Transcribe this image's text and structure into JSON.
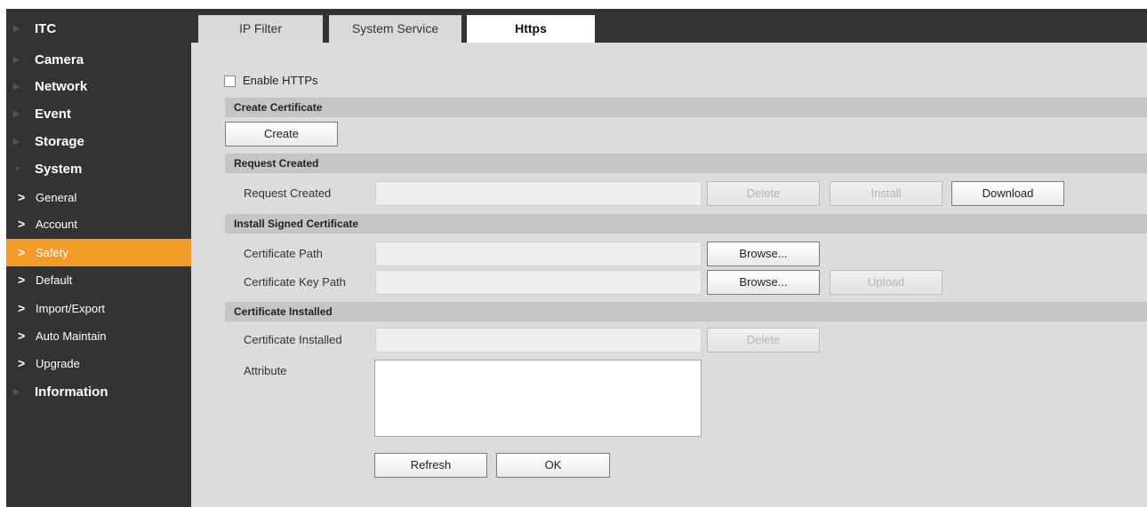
{
  "sidebar": {
    "top_items": [
      {
        "label": "ITC"
      },
      {
        "label": "Camera"
      },
      {
        "label": "Network"
      },
      {
        "label": "Event"
      },
      {
        "label": "Storage"
      },
      {
        "label": "System"
      }
    ],
    "system_subitems": [
      {
        "label": "General"
      },
      {
        "label": "Account"
      },
      {
        "label": "Safety",
        "active": true
      },
      {
        "label": "Default"
      },
      {
        "label": "Import/Export"
      },
      {
        "label": "Auto Maintain"
      },
      {
        "label": "Upgrade"
      }
    ],
    "bottom_item": {
      "label": "Information"
    },
    "active_color": "#f39b27"
  },
  "tabs": [
    {
      "label": "IP Filter"
    },
    {
      "label": "System Service"
    },
    {
      "label": "Https",
      "active": true
    }
  ],
  "https": {
    "enable_label": "Enable HTTPs",
    "enable_checked": false,
    "sections": {
      "create": "Create Certificate",
      "request": "Request Created",
      "install": "Install Signed Certificate",
      "installed": "Certificate Installed"
    },
    "create_button": "Create",
    "request_created_label": "Request Created",
    "request_created_value": "",
    "delete_button": "Delete",
    "install_button": "Install",
    "download_button": "Download",
    "cert_path_label": "Certificate Path",
    "cert_path_value": "",
    "cert_key_path_label": "Certificate Key Path",
    "cert_key_path_value": "",
    "browse_button": "Browse...",
    "upload_button": "Upload",
    "cert_installed_label": "Certificate Installed",
    "cert_installed_value": "",
    "attribute_label": "Attribute",
    "attribute_value": "",
    "refresh_button": "Refresh",
    "ok_button": "OK"
  },
  "theme": {
    "sidebar_bg": "#333333",
    "content_bg": "#dcdcdc",
    "section_bg": "#c5c5c5"
  }
}
